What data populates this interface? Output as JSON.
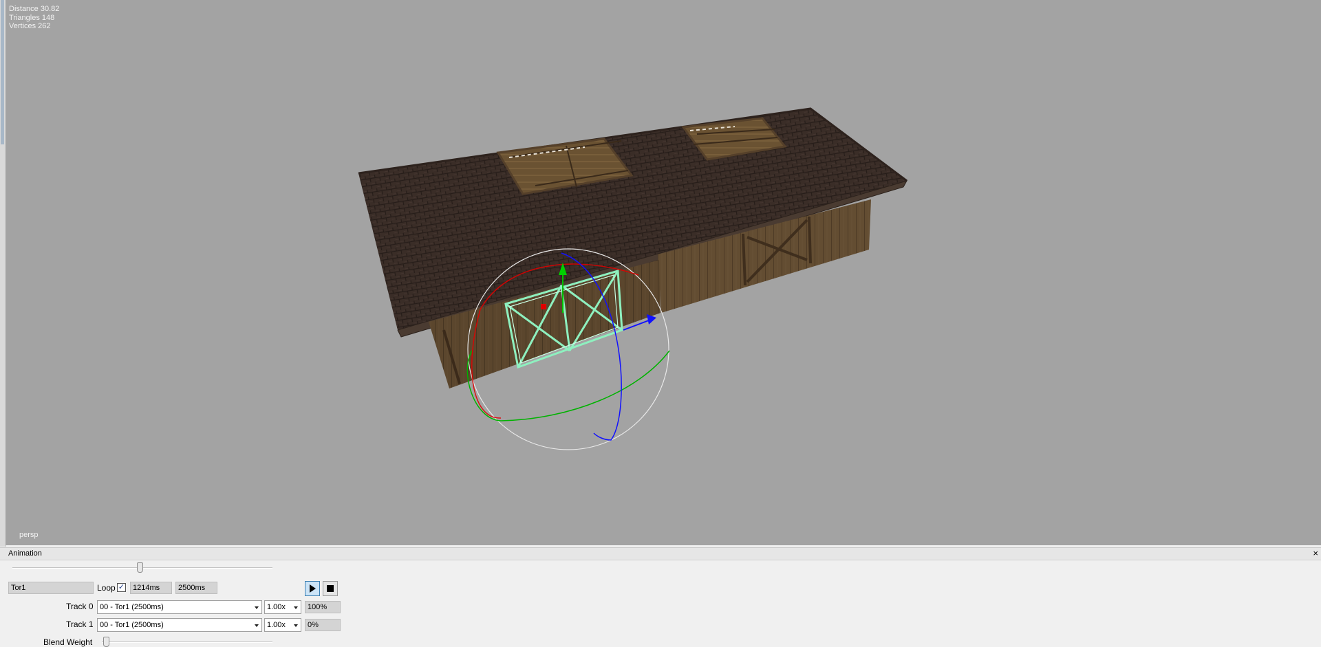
{
  "viewport": {
    "stats": {
      "distance": "Distance 30.82",
      "triangles": "Triangles 148",
      "vertices": "Vertices 262"
    },
    "camera_label": "persp",
    "background_color": "#a3a3a3"
  },
  "animation_panel": {
    "title": "Animation",
    "close_icon": "×",
    "timeline_slider_fraction": 0.49,
    "clip_name": "Tor1",
    "loop_label": "Loop",
    "loop_checked": true,
    "current_time": "1214ms",
    "total_time": "2500ms",
    "play_icon": "play-icon",
    "stop_icon": "stop-icon",
    "tracks": [
      {
        "label": "Track 0",
        "clip": "00 - Tor1 (2500ms)",
        "speed": "1.00x",
        "weight": "100%"
      },
      {
        "label": "Track 1",
        "clip": "00 - Tor1 (2500ms)",
        "speed": "1.00x",
        "weight": "0%"
      }
    ],
    "blend_weight_label": "Blend Weight",
    "blend_weight_fraction": 0.0
  }
}
